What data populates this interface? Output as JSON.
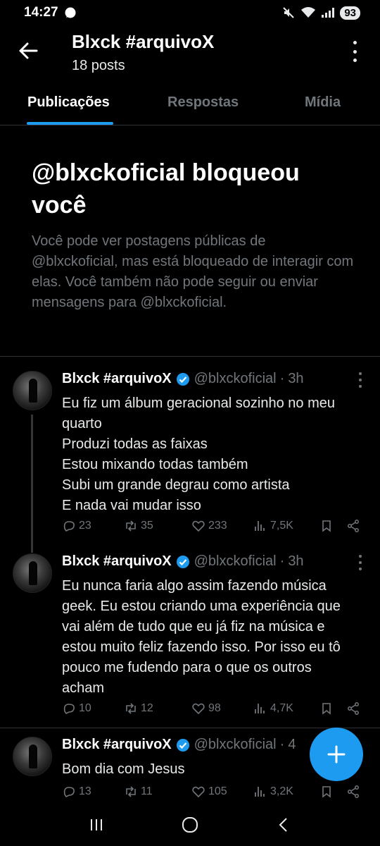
{
  "status_bar": {
    "time": "14:27",
    "battery": "93"
  },
  "header": {
    "title": "Blxck #arquivoX",
    "subtitle": "18 posts"
  },
  "tabs": [
    {
      "label": "Publicações",
      "active": true
    },
    {
      "label": "Respostas",
      "active": false
    },
    {
      "label": "Mídia",
      "active": false
    }
  ],
  "blocked": {
    "heading": "@blxckoficial bloqueou você",
    "body": "Você pode ver postagens públicas de @blxckoficial, mas está bloqueado de interagir com elas. Você também não pode seguir ou enviar mensagens para @blxckoficial."
  },
  "tweets": [
    {
      "name": "Blxck #arquivoX",
      "handle": "@blxckoficial",
      "dot": "·",
      "time": "3h",
      "lines": [
        "Eu fiz um álbum geracional sozinho no meu",
        "quarto",
        "Produzi todas as faixas",
        "Estou mixando todas também",
        "Subi um grande degrau como artista",
        "E nada vai mudar isso"
      ],
      "replies": "23",
      "reposts": "35",
      "likes": "233",
      "views": "7,5K"
    },
    {
      "name": "Blxck #arquivoX",
      "handle": "@blxckoficial",
      "dot": "·",
      "time": "3h",
      "lines": [
        "Eu nunca faria algo assim fazendo música",
        "geek. Eu estou criando uma experiência que",
        "vai além de tudo que eu já fiz na música e",
        "estou muito feliz fazendo isso. Por isso eu tô",
        "pouco me fudendo para o que os outros",
        "acham"
      ],
      "replies": "10",
      "reposts": "12",
      "likes": "98",
      "views": "4,7K"
    },
    {
      "name": "Blxck #arquivoX",
      "handle": "@blxckoficial",
      "dot": "·",
      "time": "4",
      "lines": [
        "Bom dia com Jesus"
      ],
      "replies": "13",
      "reposts": "11",
      "likes": "105",
      "views": "3,2K"
    }
  ],
  "colors": {
    "accent": "#1d9bf0",
    "muted": "#71767b",
    "background": "#000000"
  }
}
